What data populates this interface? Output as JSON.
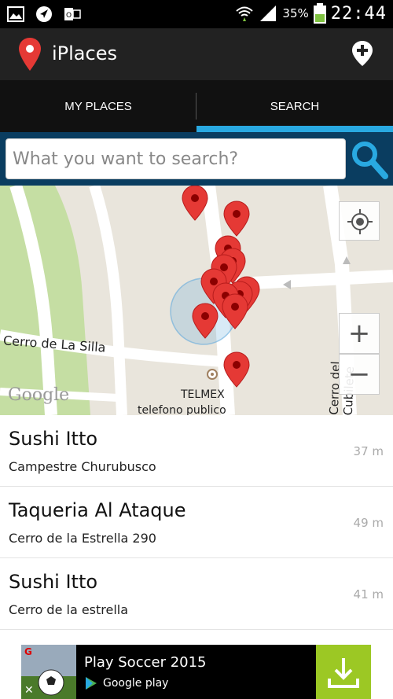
{
  "status_bar": {
    "battery_percent": "35%",
    "time": "22:44",
    "icons": [
      "image-icon",
      "navigation-icon",
      "outlook-icon",
      "wifi-icon",
      "signal-icon",
      "battery-icon"
    ]
  },
  "app": {
    "title": "iPlaces"
  },
  "tabs": [
    {
      "label": "MY PLACES",
      "selected": false
    },
    {
      "label": "SEARCH",
      "selected": true
    }
  ],
  "search": {
    "placeholder": "What you want to search?"
  },
  "map": {
    "street_labels": [
      "Cerro de La Silla",
      "Cerro del Cubilete"
    ],
    "poi_label": "TELMEX",
    "poi_sublabel": "telefono publico",
    "attribution": "Google",
    "zoom_in": "+",
    "zoom_out": "−"
  },
  "places": [
    {
      "name": "Sushi Itto",
      "address": "Campestre Churubusco",
      "distance": "37 m"
    },
    {
      "name": "Taqueria Al Ataque",
      "address": "Cerro de la Estrella 290",
      "distance": "49 m"
    },
    {
      "name": "Sushi Itto",
      "address": "Cerro de la estrella",
      "distance": "41 m"
    }
  ],
  "ad": {
    "title": "Play Soccer 2015",
    "store": "Google play",
    "close": "✕"
  },
  "colors": {
    "accent": "#29a9e1",
    "action_bar": "#222222",
    "search_bar": "#0a3d60",
    "marker": "#e53935",
    "ad_download": "#9cc824"
  }
}
